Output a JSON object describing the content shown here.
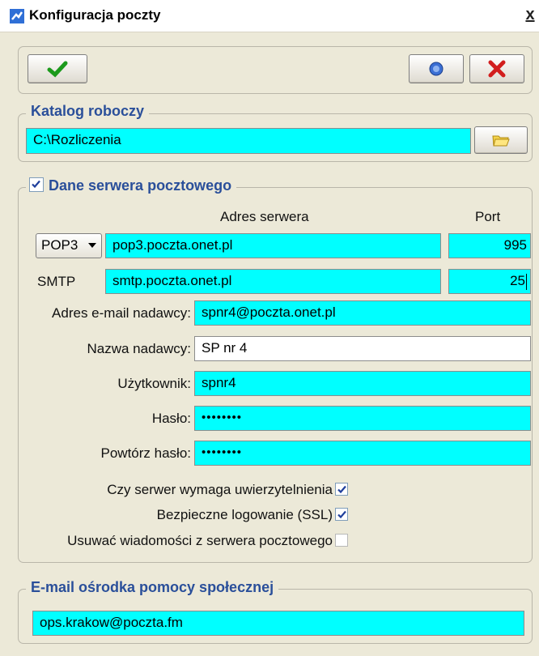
{
  "window": {
    "title": "Konfiguracja poczty",
    "close_glyph": "x",
    "icon": "envelope-app-icon"
  },
  "toolbar": {
    "ok_icon": "green-check-icon",
    "help_icon": "help-icon",
    "cancel_icon": "red-x-icon"
  },
  "working_dir": {
    "legend": "Katalog roboczy",
    "path": "C:\\Rozliczenia",
    "browse_icon": "folder-icon"
  },
  "server": {
    "legend": "Dane serwera pocztowego",
    "enabled": true,
    "col_address": "Adres serwera",
    "col_port": "Port",
    "incoming_protocol": "POP3",
    "incoming_address": "pop3.poczta.onet.pl",
    "incoming_port": "995",
    "outgoing_label": "SMTP",
    "outgoing_address": "smtp.poczta.onet.pl",
    "outgoing_port": "25",
    "sender_email_label": "Adres e-mail nadawcy:",
    "sender_email": "spnr4@poczta.onet.pl",
    "sender_name_label": "Nazwa nadawcy:",
    "sender_name": "SP nr 4",
    "user_label": "Użytkownik:",
    "user": "spnr4",
    "password_label": "Hasło:",
    "password": "••••••••",
    "password_repeat_label": "Powtórz hasło:",
    "password_repeat": "••••••••",
    "auth_label": "Czy serwer wymaga uwierzytelnienia",
    "auth_checked": true,
    "ssl_label": "Bezpieczne logowanie (SSL)",
    "ssl_checked": true,
    "delete_label": "Usuwać wiadomości z serwera pocztowego",
    "delete_checked": false
  },
  "help_center": {
    "legend": "E-mail ośrodka pomocy społecznej",
    "email": "ops.krakow@poczta.fm"
  },
  "colors": {
    "field_highlight": "#00ffff",
    "legend_text": "#2a4f9a",
    "background": "#ece9d8"
  }
}
